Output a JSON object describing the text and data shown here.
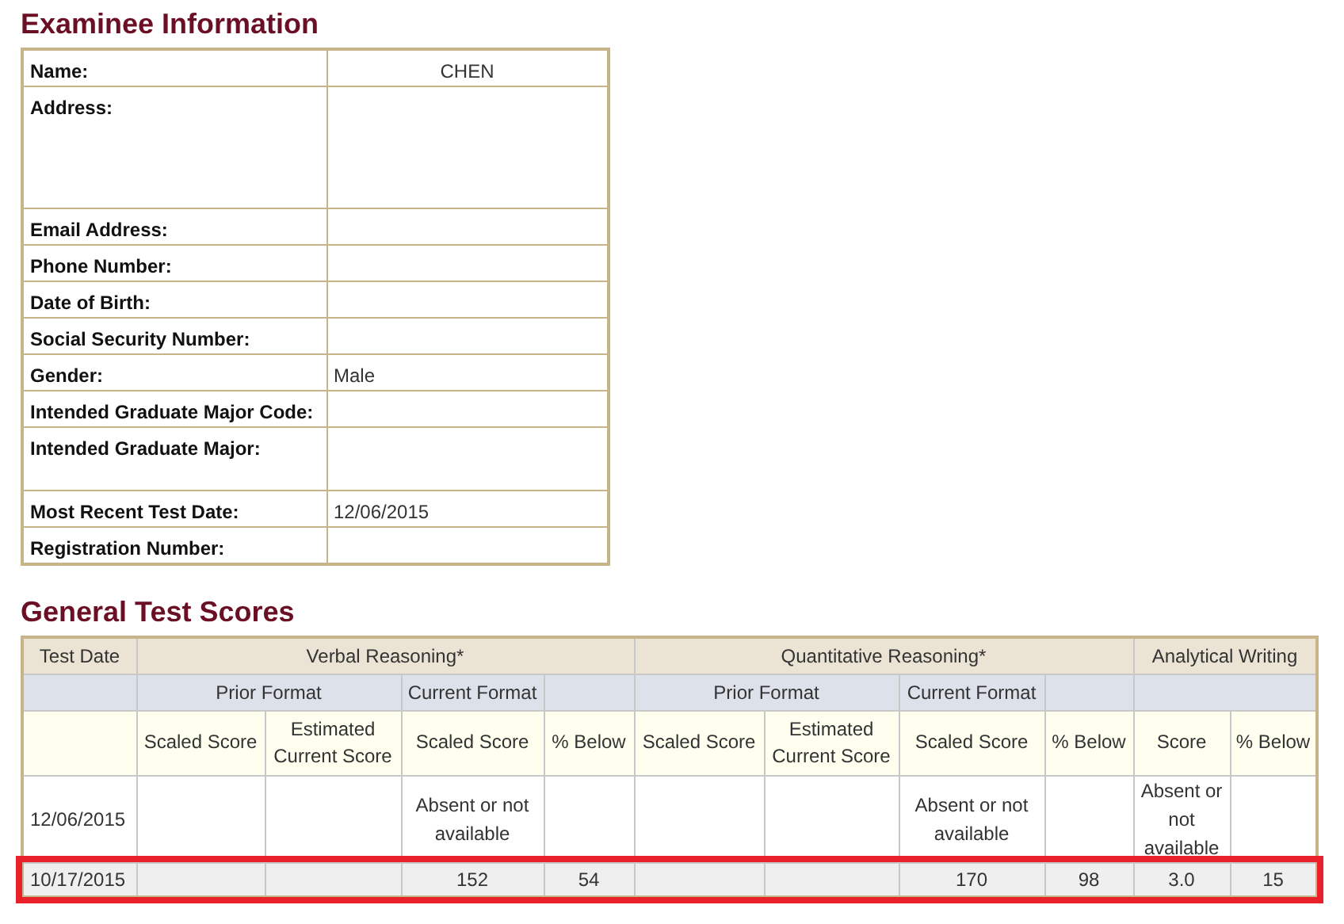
{
  "examinee": {
    "title": "Examinee Information",
    "fields": [
      {
        "label": "Name:",
        "value": "CHEN",
        "kind": "name"
      },
      {
        "label": "Address:",
        "kind": "tall"
      },
      {
        "label": "Email Address:",
        "kind": "text"
      },
      {
        "label": "Phone Number:",
        "kind": "text"
      },
      {
        "label": "Date of Birth:",
        "kind": "text"
      },
      {
        "label": "Social Security Number:",
        "kind": "text"
      },
      {
        "label": "Gender:",
        "value": "Male",
        "kind": "text"
      },
      {
        "label": "Intended Graduate Major Code:",
        "kind": "text"
      },
      {
        "label": "Intended Graduate Major:",
        "kind": "medium"
      },
      {
        "label": "Most Recent Test Date:",
        "value": "12/06/2015",
        "kind": "text"
      },
      {
        "label": "Registration Number:",
        "kind": "text"
      }
    ]
  },
  "scores": {
    "title": "General Test Scores",
    "test_date_header": "Test Date",
    "sections": [
      {
        "label": "Verbal Reasoning*",
        "formats": [
          {
            "label": "Prior Format",
            "columns": [
              "Scaled Score",
              "Estimated Current Score"
            ]
          },
          {
            "label": "Current Format",
            "columns": [
              "Scaled Score"
            ]
          },
          {
            "columns": [
              "% Below"
            ]
          }
        ]
      },
      {
        "label": "Quantitative Reasoning*",
        "formats": [
          {
            "label": "Prior Format",
            "columns": [
              "Scaled Score",
              "Estimated Current Score"
            ]
          },
          {
            "label": "Current Format",
            "columns": [
              "Scaled Score"
            ]
          },
          {
            "columns": [
              "% Below"
            ]
          }
        ]
      },
      {
        "label": "Analytical Writing",
        "formats": [
          {
            "columns": [
              "Score",
              "% Below"
            ]
          }
        ]
      }
    ],
    "rows": [
      {
        "test_date": "12/06/2015",
        "highlighted": false,
        "cells": [
          null,
          null,
          "Absent or not available",
          null,
          null,
          null,
          "Absent or not available",
          null,
          "Absent or not available",
          null
        ]
      },
      {
        "test_date": "10/17/2015",
        "highlighted": true,
        "cells": [
          null,
          null,
          "152",
          "54",
          null,
          null,
          "170",
          "98",
          "3.0",
          "15"
        ]
      }
    ]
  }
}
